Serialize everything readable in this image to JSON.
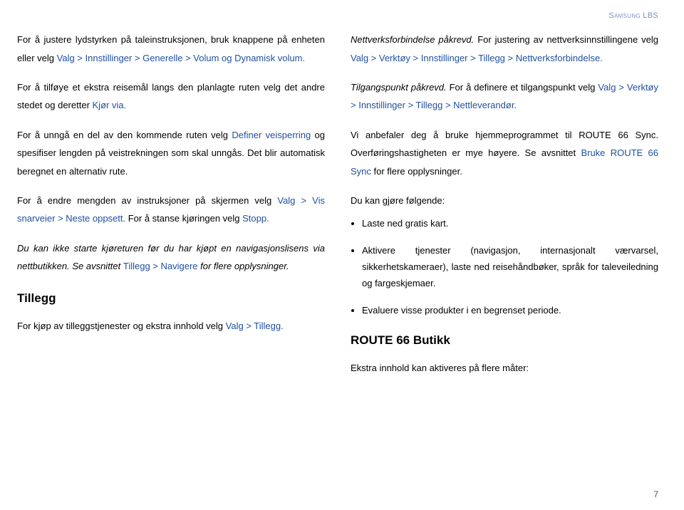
{
  "header": "Samsung LBS",
  "left": {
    "p1a": "For å justere lydstyrken på taleinstruksjonen, bruk knappene på enheten eller velg ",
    "p1b": "Valg > Innstillinger > Generelle > Volum og Dynamisk volum.",
    "p2a": "For å tilføye et ekstra reisemål langs den planlagte ruten velg det andre stedet og deretter ",
    "p2b": "Kjør via.",
    "p3a": "For å unngå en del av den kommende ruten velg ",
    "p3b": "Definer veisperring",
    "p3c": " og spesifiser lengden på veistrekningen som skal unngås. Det blir automatisk beregnet en alternativ rute.",
    "p4a": "For å endre mengden av instruksjoner på skjermen velg ",
    "p4b": "Valg > Vis snarveier > Neste oppsett.",
    "p4c": " For å stanse kjøringen velg ",
    "p4d": "Stopp.",
    "p5a": "Du kan ikke starte kjøreturen før du har kjøpt en navigasjonslisens via nettbutikken. Se avsnittet ",
    "p5b": "Tillegg > Navigere",
    "p5c": " for flere opplysninger.",
    "h": "Tillegg",
    "p6a": "For kjøp av tilleggstjenester og ekstra innhold velg ",
    "p6b": "Valg > Tillegg."
  },
  "right": {
    "p1a": "Nettverksforbindelse påkrevd.",
    "p1b": " For justering av nettverksinnstillingene velg ",
    "p1c": "Valg > Verktøy > Innstillinger > Tillegg > Nettverksforbindelse.",
    "p2a": "Tilgangspunkt påkrevd.",
    "p2b": " For å definere et tilgangspunkt velg ",
    "p2c": "Valg > Verktøy > Innstillinger > Tillegg > Nettleverandør.",
    "p3a": "Vi anbefaler deg å bruke hjemmeprogrammet til ROUTE 66 Sync. Overføringshastigheten er mye høyere. Se avsnittet ",
    "p3b": "Bruke ROUTE 66 Sync",
    "p3c": " for flere opplysninger.",
    "p4": "Du kan gjøre følgende:",
    "li1": "Laste ned gratis kart.",
    "li2": "Aktivere tjenester (navigasjon, internasjonalt værvarsel, sikkerhetskameraer), laste ned reisehåndbøker, språk for taleveiledning og fargeskjemaer.",
    "li3": "Evaluere visse produkter i en begrenset periode.",
    "h": "ROUTE 66 Butikk",
    "p5": "Ekstra innhold kan aktiveres på flere måter:"
  },
  "page": "7"
}
